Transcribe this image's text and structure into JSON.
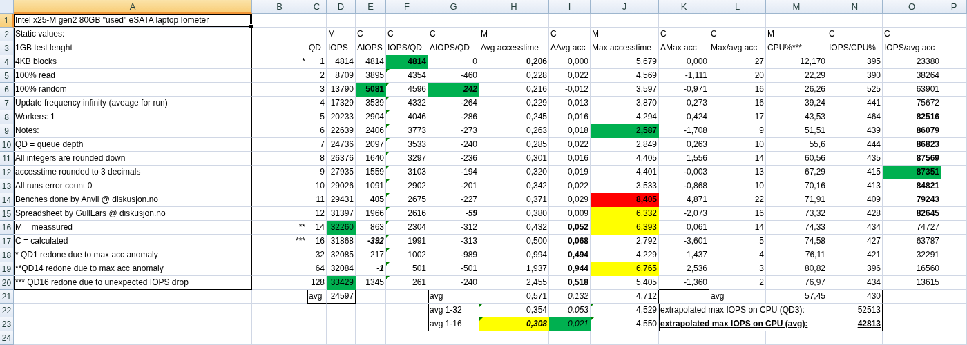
{
  "columns": [
    {
      "label": "A",
      "selected": true
    },
    {
      "label": "B",
      "selected": false
    },
    {
      "label": "C",
      "selected": false
    },
    {
      "label": "D",
      "selected": false
    },
    {
      "label": "E",
      "selected": false
    },
    {
      "label": "F",
      "selected": false
    },
    {
      "label": "G",
      "selected": false
    },
    {
      "label": "H",
      "selected": false
    },
    {
      "label": "I",
      "selected": false
    },
    {
      "label": "J",
      "selected": false
    },
    {
      "label": "K",
      "selected": false
    },
    {
      "label": "L",
      "selected": false
    },
    {
      "label": "M",
      "selected": false
    },
    {
      "label": "N",
      "selected": false
    },
    {
      "label": "O",
      "selected": false
    },
    {
      "label": "P",
      "selected": false
    }
  ],
  "rows": [
    {
      "label": "1",
      "selected": true,
      "cells": [
        {
          "text": "Intel x25-M gen2 80GB \"used\" eSATA laptop Iometer",
          "kind": "text",
          "border_top": true,
          "border_left": true,
          "border_right": true
        }
      ]
    },
    {
      "label": "2",
      "selected": false,
      "cells": [
        {
          "text": "Static  values:",
          "kind": "text",
          "border_left": true,
          "border_right": true
        },
        null,
        null,
        {
          "text": "M",
          "kind": "text"
        },
        {
          "text": "C",
          "kind": "text"
        },
        {
          "text": "C",
          "kind": "text"
        },
        {
          "text": "C",
          "kind": "text"
        },
        {
          "text": "M",
          "kind": "text"
        },
        {
          "text": "C",
          "kind": "text"
        },
        {
          "text": "M",
          "kind": "text"
        },
        {
          "text": "C",
          "kind": "text"
        },
        {
          "text": "C",
          "kind": "text"
        },
        {
          "text": "M",
          "kind": "text"
        },
        {
          "text": "C",
          "kind": "text"
        },
        {
          "text": "C",
          "kind": "text"
        }
      ]
    },
    {
      "label": "3",
      "selected": false,
      "cells": [
        {
          "text": "1GB test lenght",
          "kind": "text",
          "border_left": true,
          "border_right": true
        },
        null,
        {
          "text": "QD",
          "kind": "text"
        },
        {
          "text": "IOPS",
          "kind": "text"
        },
        {
          "text": "ΔIOPS",
          "kind": "text"
        },
        {
          "text": "IOPS/QD",
          "kind": "text"
        },
        {
          "text": "ΔIOPS/QD",
          "kind": "text"
        },
        {
          "text": "Avg accesstime",
          "kind": "text"
        },
        {
          "text": "ΔAvg acc",
          "kind": "text"
        },
        {
          "text": "Max accesstime",
          "kind": "text"
        },
        {
          "text": "ΔMax acc",
          "kind": "text"
        },
        {
          "text": "Max/avg acc",
          "kind": "text"
        },
        {
          "text": "CPU%***",
          "kind": "text"
        },
        {
          "text": "IOPS/CPU%",
          "kind": "text"
        },
        {
          "text": "IOPS/avg acc",
          "kind": "text"
        }
      ]
    },
    {
      "label": "4",
      "selected": false,
      "cells": [
        {
          "text": "4KB blocks",
          "kind": "text",
          "border_left": true,
          "border_right": true
        },
        {
          "text": "*",
          "kind": "num"
        },
        {
          "text": "1",
          "kind": "num"
        },
        {
          "text": "4814",
          "kind": "num"
        },
        {
          "text": "4814",
          "kind": "num"
        },
        {
          "text": "4814",
          "kind": "num",
          "bold": true,
          "color": "#00b050"
        },
        {
          "text": "0",
          "kind": "num"
        },
        {
          "text": "0,206",
          "kind": "num",
          "bold": true
        },
        {
          "text": "0,000",
          "kind": "num"
        },
        {
          "text": "5,679",
          "kind": "num"
        },
        {
          "text": "0,000",
          "kind": "num"
        },
        {
          "text": "27",
          "kind": "num"
        },
        {
          "text": "12,170",
          "kind": "num"
        },
        {
          "text": "395",
          "kind": "num"
        },
        {
          "text": "23380",
          "kind": "num"
        }
      ]
    },
    {
      "label": "5",
      "selected": false,
      "cells": [
        {
          "text": "100% read",
          "kind": "text",
          "border_left": true,
          "border_right": true
        },
        null,
        {
          "text": "2",
          "kind": "num"
        },
        {
          "text": "8709",
          "kind": "num"
        },
        {
          "text": "3895",
          "kind": "num"
        },
        {
          "text": "4354",
          "kind": "num",
          "flag": true
        },
        {
          "text": "-460",
          "kind": "num"
        },
        {
          "text": "0,228",
          "kind": "num"
        },
        {
          "text": "0,022",
          "kind": "num"
        },
        {
          "text": "4,569",
          "kind": "num"
        },
        {
          "text": "-1,111",
          "kind": "num"
        },
        {
          "text": "20",
          "kind": "num"
        },
        {
          "text": "22,29",
          "kind": "num"
        },
        {
          "text": "390",
          "kind": "num"
        },
        {
          "text": "38264",
          "kind": "num"
        }
      ]
    },
    {
      "label": "6",
      "selected": false,
      "cells": [
        {
          "text": "100% random",
          "kind": "text",
          "border_left": true,
          "border_right": true
        },
        null,
        {
          "text": "3",
          "kind": "num"
        },
        {
          "text": "13790",
          "kind": "num"
        },
        {
          "text": "5081",
          "kind": "num",
          "bold": true,
          "color": "#00b050"
        },
        {
          "text": "4596",
          "kind": "num",
          "flag": true
        },
        {
          "text": "242",
          "kind": "num",
          "bold": true,
          "italic": true,
          "color": "#00b050"
        },
        {
          "text": "0,216",
          "kind": "num"
        },
        {
          "text": "-0,012",
          "kind": "num"
        },
        {
          "text": "3,597",
          "kind": "num"
        },
        {
          "text": "-0,971",
          "kind": "num"
        },
        {
          "text": "16",
          "kind": "num"
        },
        {
          "text": "26,26",
          "kind": "num"
        },
        {
          "text": "525",
          "kind": "num"
        },
        {
          "text": "63901",
          "kind": "num"
        }
      ]
    },
    {
      "label": "7",
      "selected": false,
      "cells": [
        {
          "text": "Update frequency infinity (aveage for run)",
          "kind": "text",
          "border_left": true,
          "border_right": true
        },
        null,
        {
          "text": "4",
          "kind": "num"
        },
        {
          "text": "17329",
          "kind": "num"
        },
        {
          "text": "3539",
          "kind": "num"
        },
        {
          "text": "4332",
          "kind": "num",
          "flag": true
        },
        {
          "text": "-264",
          "kind": "num"
        },
        {
          "text": "0,229",
          "kind": "num"
        },
        {
          "text": "0,013",
          "kind": "num"
        },
        {
          "text": "3,870",
          "kind": "num"
        },
        {
          "text": "0,273",
          "kind": "num"
        },
        {
          "text": "16",
          "kind": "num"
        },
        {
          "text": "39,24",
          "kind": "num"
        },
        {
          "text": "441",
          "kind": "num"
        },
        {
          "text": "75672",
          "kind": "num"
        }
      ]
    },
    {
      "label": "8",
      "selected": false,
      "cells": [
        {
          "text": "Workers: 1",
          "kind": "text",
          "border_left": true,
          "border_right": true
        },
        null,
        {
          "text": "5",
          "kind": "num"
        },
        {
          "text": "20233",
          "kind": "num"
        },
        {
          "text": "2904",
          "kind": "num"
        },
        {
          "text": "4046",
          "kind": "num",
          "flag": true
        },
        {
          "text": "-286",
          "kind": "num"
        },
        {
          "text": "0,245",
          "kind": "num"
        },
        {
          "text": "0,016",
          "kind": "num"
        },
        {
          "text": "4,294",
          "kind": "num"
        },
        {
          "text": "0,424",
          "kind": "num"
        },
        {
          "text": "17",
          "kind": "num"
        },
        {
          "text": "43,53",
          "kind": "num"
        },
        {
          "text": "464",
          "kind": "num"
        },
        {
          "text": "82516",
          "kind": "num",
          "bold": true
        }
      ]
    },
    {
      "label": "9",
      "selected": false,
      "cells": [
        {
          "text": "Notes:",
          "kind": "text",
          "border_left": true,
          "border_right": true
        },
        null,
        {
          "text": "6",
          "kind": "num"
        },
        {
          "text": "22639",
          "kind": "num"
        },
        {
          "text": "2406",
          "kind": "num"
        },
        {
          "text": "3773",
          "kind": "num",
          "flag": true
        },
        {
          "text": "-273",
          "kind": "num"
        },
        {
          "text": "0,263",
          "kind": "num"
        },
        {
          "text": "0,018",
          "kind": "num"
        },
        {
          "text": "2,587",
          "kind": "num",
          "bold": true,
          "color": "#00b050"
        },
        {
          "text": "-1,708",
          "kind": "num"
        },
        {
          "text": "9",
          "kind": "num"
        },
        {
          "text": "51,51",
          "kind": "num"
        },
        {
          "text": "439",
          "kind": "num"
        },
        {
          "text": "86079",
          "kind": "num",
          "bold": true
        }
      ]
    },
    {
      "label": "10",
      "selected": false,
      "cells": [
        {
          "text": "QD = queue depth",
          "kind": "text",
          "border_left": true,
          "border_right": true
        },
        null,
        {
          "text": "7",
          "kind": "num"
        },
        {
          "text": "24736",
          "kind": "num"
        },
        {
          "text": "2097",
          "kind": "num"
        },
        {
          "text": "3533",
          "kind": "num",
          "flag": true
        },
        {
          "text": "-240",
          "kind": "num"
        },
        {
          "text": "0,285",
          "kind": "num"
        },
        {
          "text": "0,022",
          "kind": "num"
        },
        {
          "text": "2,849",
          "kind": "num"
        },
        {
          "text": "0,263",
          "kind": "num"
        },
        {
          "text": "10",
          "kind": "num"
        },
        {
          "text": "55,6",
          "kind": "num"
        },
        {
          "text": "444",
          "kind": "num"
        },
        {
          "text": "86823",
          "kind": "num",
          "bold": true
        }
      ]
    },
    {
      "label": "11",
      "selected": false,
      "cells": [
        {
          "text": "All integers are rounded down",
          "kind": "text",
          "border_left": true,
          "border_right": true
        },
        null,
        {
          "text": "8",
          "kind": "num"
        },
        {
          "text": "26376",
          "kind": "num"
        },
        {
          "text": "1640",
          "kind": "num"
        },
        {
          "text": "3297",
          "kind": "num",
          "flag": true
        },
        {
          "text": "-236",
          "kind": "num"
        },
        {
          "text": "0,301",
          "kind": "num"
        },
        {
          "text": "0,016",
          "kind": "num"
        },
        {
          "text": "4,405",
          "kind": "num"
        },
        {
          "text": "1,556",
          "kind": "num"
        },
        {
          "text": "14",
          "kind": "num"
        },
        {
          "text": "60,56",
          "kind": "num"
        },
        {
          "text": "435",
          "kind": "num"
        },
        {
          "text": "87569",
          "kind": "num",
          "bold": true
        }
      ]
    },
    {
      "label": "12",
      "selected": false,
      "cells": [
        {
          "text": "accesstime rounded to 3 decimals",
          "kind": "text",
          "border_left": true,
          "border_right": true
        },
        null,
        {
          "text": "9",
          "kind": "num"
        },
        {
          "text": "27935",
          "kind": "num"
        },
        {
          "text": "1559",
          "kind": "num"
        },
        {
          "text": "3103",
          "kind": "num",
          "flag": true
        },
        {
          "text": "-194",
          "kind": "num"
        },
        {
          "text": "0,320",
          "kind": "num"
        },
        {
          "text": "0,019",
          "kind": "num"
        },
        {
          "text": "4,401",
          "kind": "num"
        },
        {
          "text": "-0,003",
          "kind": "num"
        },
        {
          "text": "13",
          "kind": "num"
        },
        {
          "text": "67,29",
          "kind": "num"
        },
        {
          "text": "415",
          "kind": "num"
        },
        {
          "text": "87351",
          "kind": "num",
          "bold": true,
          "color": "#00b050"
        }
      ]
    },
    {
      "label": "13",
      "selected": false,
      "cells": [
        {
          "text": "All runs error count 0",
          "kind": "text",
          "border_left": true,
          "border_right": true
        },
        null,
        {
          "text": "10",
          "kind": "num"
        },
        {
          "text": "29026",
          "kind": "num"
        },
        {
          "text": "1091",
          "kind": "num"
        },
        {
          "text": "2902",
          "kind": "num",
          "flag": true
        },
        {
          "text": "-201",
          "kind": "num"
        },
        {
          "text": "0,342",
          "kind": "num"
        },
        {
          "text": "0,022",
          "kind": "num"
        },
        {
          "text": "3,533",
          "kind": "num"
        },
        {
          "text": "-0,868",
          "kind": "num"
        },
        {
          "text": "10",
          "kind": "num"
        },
        {
          "text": "70,16",
          "kind": "num"
        },
        {
          "text": "413",
          "kind": "num"
        },
        {
          "text": "84821",
          "kind": "num",
          "bold": true
        }
      ]
    },
    {
      "label": "14",
      "selected": false,
      "cells": [
        {
          "text": "Benches done by Anvil @ diskusjon.no",
          "kind": "text",
          "border_left": true,
          "border_right": true
        },
        null,
        {
          "text": "11",
          "kind": "num"
        },
        {
          "text": "29431",
          "kind": "num"
        },
        {
          "text": "405",
          "kind": "num",
          "bold": true
        },
        {
          "text": "2675",
          "kind": "num",
          "flag": true
        },
        {
          "text": "-227",
          "kind": "num"
        },
        {
          "text": "0,371",
          "kind": "num"
        },
        {
          "text": "0,029",
          "kind": "num"
        },
        {
          "text": "8,405",
          "kind": "num",
          "bold": true,
          "color": "#ff0000"
        },
        {
          "text": "4,871",
          "kind": "num"
        },
        {
          "text": "22",
          "kind": "num"
        },
        {
          "text": "71,91",
          "kind": "num"
        },
        {
          "text": "409",
          "kind": "num"
        },
        {
          "text": "79243",
          "kind": "num",
          "bold": true
        }
      ]
    },
    {
      "label": "15",
      "selected": false,
      "cells": [
        {
          "text": "Spreadsheet by GullLars @ diskusjon.no",
          "kind": "text",
          "border_left": true,
          "border_right": true
        },
        null,
        {
          "text": "12",
          "kind": "num"
        },
        {
          "text": "31397",
          "kind": "num"
        },
        {
          "text": "1966",
          "kind": "num"
        },
        {
          "text": "2616",
          "kind": "num",
          "flag": true
        },
        {
          "text": "-59",
          "kind": "num",
          "bold": true,
          "italic": true
        },
        {
          "text": "0,380",
          "kind": "num"
        },
        {
          "text": "0,009",
          "kind": "num"
        },
        {
          "text": "6,332",
          "kind": "num",
          "color": "#ffff00"
        },
        {
          "text": "-2,073",
          "kind": "num"
        },
        {
          "text": "16",
          "kind": "num"
        },
        {
          "text": "73,32",
          "kind": "num"
        },
        {
          "text": "428",
          "kind": "num"
        },
        {
          "text": "82645",
          "kind": "num",
          "bold": true
        }
      ]
    },
    {
      "label": "16",
      "selected": false,
      "cells": [
        {
          "text": "M = meassured",
          "kind": "text",
          "border_left": true,
          "border_right": true
        },
        {
          "text": "**",
          "kind": "num"
        },
        {
          "text": "14",
          "kind": "num"
        },
        {
          "text": "32260",
          "kind": "num",
          "color": "#00b050"
        },
        {
          "text": "863",
          "kind": "num"
        },
        {
          "text": "2304",
          "kind": "num",
          "flag": true
        },
        {
          "text": "-312",
          "kind": "num"
        },
        {
          "text": "0,432",
          "kind": "num"
        },
        {
          "text": "0,052",
          "kind": "num",
          "bold": true
        },
        {
          "text": "6,393",
          "kind": "num",
          "color": "#ffff00"
        },
        {
          "text": "0,061",
          "kind": "num"
        },
        {
          "text": "14",
          "kind": "num"
        },
        {
          "text": "74,33",
          "kind": "num"
        },
        {
          "text": "434",
          "kind": "num"
        },
        {
          "text": "74727",
          "kind": "num"
        }
      ]
    },
    {
      "label": "17",
      "selected": false,
      "cells": [
        {
          "text": "C = calculated",
          "kind": "text",
          "border_left": true,
          "border_right": true
        },
        {
          "text": "***",
          "kind": "num"
        },
        {
          "text": "16",
          "kind": "num"
        },
        {
          "text": "31868",
          "kind": "num"
        },
        {
          "text": "-392",
          "kind": "num",
          "bold": true,
          "italic": true
        },
        {
          "text": "1991",
          "kind": "num",
          "flag": true
        },
        {
          "text": "-313",
          "kind": "num"
        },
        {
          "text": "0,500",
          "kind": "num"
        },
        {
          "text": "0,068",
          "kind": "num",
          "bold": true
        },
        {
          "text": "2,792",
          "kind": "num"
        },
        {
          "text": "-3,601",
          "kind": "num"
        },
        {
          "text": "5",
          "kind": "num"
        },
        {
          "text": "74,58",
          "kind": "num"
        },
        {
          "text": "427",
          "kind": "num"
        },
        {
          "text": "63787",
          "kind": "num"
        }
      ]
    },
    {
      "label": "18",
      "selected": false,
      "cells": [
        {
          "text": "* QD1 redone due to max acc anomaly",
          "kind": "text",
          "border_left": true,
          "border_right": true
        },
        null,
        {
          "text": "32",
          "kind": "num"
        },
        {
          "text": "32085",
          "kind": "num"
        },
        {
          "text": "217",
          "kind": "num"
        },
        {
          "text": "1002",
          "kind": "num",
          "flag": true
        },
        {
          "text": "-989",
          "kind": "num"
        },
        {
          "text": "0,994",
          "kind": "num"
        },
        {
          "text": "0,494",
          "kind": "num",
          "bold": true
        },
        {
          "text": "4,229",
          "kind": "num"
        },
        {
          "text": "1,437",
          "kind": "num"
        },
        {
          "text": "4",
          "kind": "num"
        },
        {
          "text": "76,11",
          "kind": "num"
        },
        {
          "text": "421",
          "kind": "num"
        },
        {
          "text": "32291",
          "kind": "num"
        }
      ]
    },
    {
      "label": "19",
      "selected": false,
      "cells": [
        {
          "text": "**QD14 redone due to max acc anomaly",
          "kind": "text",
          "border_left": true,
          "border_right": true
        },
        null,
        {
          "text": "64",
          "kind": "num"
        },
        {
          "text": "32084",
          "kind": "num"
        },
        {
          "text": "-1",
          "kind": "num",
          "bold": true,
          "italic": true
        },
        {
          "text": "501",
          "kind": "num",
          "flag": true
        },
        {
          "text": "-501",
          "kind": "num"
        },
        {
          "text": "1,937",
          "kind": "num"
        },
        {
          "text": "0,944",
          "kind": "num",
          "bold": true
        },
        {
          "text": "6,765",
          "kind": "num",
          "color": "#ffff00"
        },
        {
          "text": "2,536",
          "kind": "num"
        },
        {
          "text": "3",
          "kind": "num"
        },
        {
          "text": "80,82",
          "kind": "num"
        },
        {
          "text": "396",
          "kind": "num"
        },
        {
          "text": "16560",
          "kind": "num"
        }
      ]
    },
    {
      "label": "20",
      "selected": false,
      "cells": [
        {
          "text": "*** QD16 redone due to unexpected IOPS drop",
          "kind": "text",
          "border_left": true,
          "border_right": true,
          "border_bottom": true
        },
        null,
        {
          "text": "128",
          "kind": "num"
        },
        {
          "text": "33429",
          "kind": "num",
          "color": "#00b050"
        },
        {
          "text": "1345",
          "kind": "num"
        },
        {
          "text": "261",
          "kind": "num",
          "flag": true
        },
        {
          "text": "-240",
          "kind": "num"
        },
        {
          "text": "2,455",
          "kind": "num"
        },
        {
          "text": "0,518",
          "kind": "num",
          "bold": true
        },
        {
          "text": "5,405",
          "kind": "num"
        },
        {
          "text": "-1,360",
          "kind": "num",
          "border_bottom": true
        },
        {
          "text": "2",
          "kind": "num"
        },
        {
          "text": "76,97",
          "kind": "num"
        },
        {
          "text": "434",
          "kind": "num"
        },
        {
          "text": "13615",
          "kind": "num"
        }
      ]
    },
    {
      "label": "21",
      "selected": false,
      "cells": [
        null,
        null,
        {
          "text": "avg",
          "kind": "text",
          "border_top": true,
          "border_left": true,
          "border_bottom": true
        },
        {
          "text": "24597",
          "kind": "num",
          "border_top": true,
          "border_right": true,
          "border_bottom": true
        },
        null,
        null,
        {
          "text": "avg",
          "kind": "text",
          "border_top": true,
          "border_left": true
        },
        {
          "text": "0,571",
          "kind": "num",
          "border_top": true
        },
        {
          "text": "0,132",
          "kind": "num",
          "italic": true,
          "border_top": true
        },
        {
          "text": "4,712",
          "kind": "num",
          "border_top": true,
          "border_right": true
        },
        null,
        {
          "text": "avg",
          "kind": "text",
          "border_top": true
        },
        {
          "text": "57,45",
          "kind": "num",
          "border_top": true
        },
        {
          "text": "430",
          "kind": "num",
          "border_top": true,
          "border_right": true
        }
      ]
    },
    {
      "label": "22",
      "selected": false,
      "cells": [
        null,
        null,
        null,
        null,
        null,
        null,
        {
          "text": "avg 1-32",
          "kind": "text",
          "border_left": true
        },
        {
          "text": "0,354",
          "kind": "num",
          "flag": true
        },
        {
          "text": "0,053",
          "kind": "num",
          "italic": true
        },
        {
          "text": "4,529",
          "kind": "num",
          "flag": true
        },
        {
          "text": "extrapolated max IOPS on CPU (QD3):",
          "kind": "wide",
          "border_left": true
        },
        null,
        null,
        {
          "text": "52513",
          "kind": "num",
          "border_right": true
        }
      ]
    },
    {
      "label": "23",
      "selected": false,
      "cells": [
        null,
        null,
        null,
        null,
        null,
        null,
        {
          "text": "avg 1-16",
          "kind": "text",
          "border_left": true,
          "border_bottom": true
        },
        {
          "text": "0,308",
          "kind": "num",
          "bold": true,
          "italic": true,
          "flag": true,
          "color": "#ffff00",
          "border_bottom": true
        },
        {
          "text": "0,021",
          "kind": "num",
          "italic": true,
          "color": "#00b050",
          "border_bottom": true
        },
        {
          "text": "4,550",
          "kind": "num",
          "flag": true,
          "border_bottom": true
        },
        {
          "text": "extrapolated max IOPS on CPU (avg):",
          "kind": "wide",
          "bold": true,
          "underline": true,
          "border_left": true,
          "border_bottom": true
        },
        null,
        null,
        {
          "text": "42813",
          "kind": "num",
          "bold": true,
          "underline": true,
          "border_right": true,
          "border_bottom": true
        }
      ]
    },
    {
      "label": "24",
      "selected": false
    }
  ]
}
